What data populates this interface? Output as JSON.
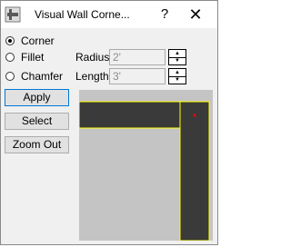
{
  "window": {
    "title": "Visual Wall Corne...",
    "help_glyph": "?",
    "close_glyph": "✕",
    "app_icon": "corner-tool-icon"
  },
  "corner_type": {
    "options": [
      {
        "label": "Corner",
        "checked": true
      },
      {
        "label": "Fillet",
        "checked": false
      },
      {
        "label": "Chamfer",
        "checked": false
      }
    ]
  },
  "radius": {
    "label": "Radius",
    "value": "2'"
  },
  "length": {
    "label": "Length",
    "value": "3'"
  },
  "buttons": {
    "apply": "Apply",
    "select": "Select",
    "zoom_out": "Zoom Out"
  },
  "colors": {
    "wall_fill": "#3a3a3a",
    "wall_outline": "#ffff00",
    "corner_marker": "#ff0000",
    "preview_background": "#c4c4c4"
  }
}
